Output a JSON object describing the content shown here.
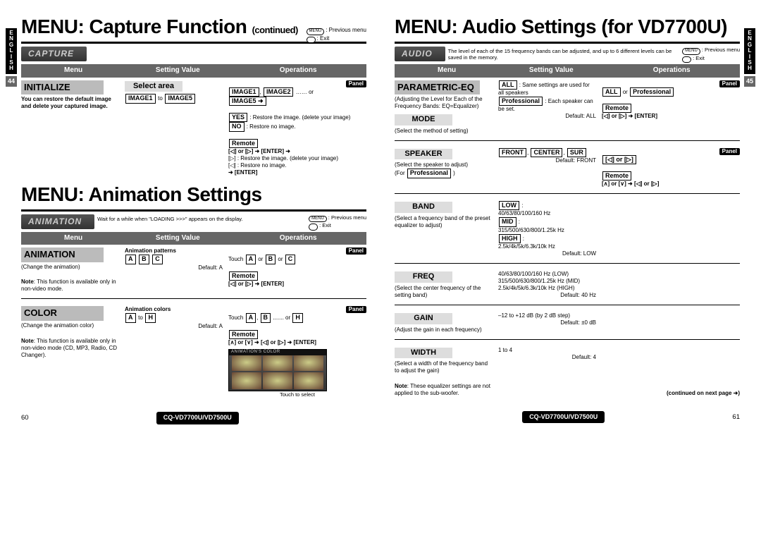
{
  "side_tab": "ENGLISH",
  "side_page_left": "44",
  "side_page_right": "45",
  "foot_left_page": "60",
  "foot_right_page": "61",
  "foot_model": "CQ-VD7700U/VD7500U",
  "nav_prev": ": Previous menu",
  "nav_exit": ": Exit",
  "left": {
    "title1": "MENU: Capture Function",
    "title1_cont": "(continued)",
    "capbar1": "CAPTURE",
    "cols": {
      "menu": "Menu",
      "setting": "Setting Value",
      "ops": "Operations"
    },
    "initialize": {
      "label": "INITIALIZE",
      "desc": "You can restore the default image and delete your captured image.",
      "select_area": "Select area",
      "range1": "IMAGE1",
      "range_to": "to",
      "range2": "IMAGE5",
      "ops1a": "IMAGE1",
      "ops1b": "IMAGE2",
      "ops1c": "…… or",
      "ops1d": "IMAGE5",
      "yes": "YES",
      "yes_desc": ": Restore the image. (delete your image)",
      "no": "NO",
      "no_desc": ": Restore no image.",
      "panel": "Panel",
      "remote": "Remote",
      "remote_line1": "[◁] or [▷] ➜ [ENTER] ➜",
      "remote_line2": "[▷] : Restore the image. (delete your image)",
      "remote_line3": "[◁] : Restore no image.",
      "remote_line4": "➜ [ENTER]"
    },
    "title2": "MENU: Animation Settings",
    "capbar2": "ANIMATION",
    "loading_note": "Wait for a while when \"LOADING >>>\" appears on the display.",
    "animation": {
      "label": "ANIMATION",
      "desc1": "(Change the animation)",
      "note_bold": "Note",
      "desc2": ": This function is available only in non-video mode.",
      "patterns_hdr": "Animation patterns",
      "a": "A",
      "b": "B",
      "c": "C",
      "default": "Default: A",
      "ops_panel": "Panel",
      "ops_touch1": "Touch ",
      "ops_remote": "Remote",
      "ops_remote_line": "[◁] or [▷] ➜ [ENTER]"
    },
    "color": {
      "label": "COLOR",
      "desc1": "(Change the animation color)",
      "desc2": ": This function is available only in non-video mode (CD, MP3, Radio, CD Changer).",
      "colors_hdr": "Animation colors",
      "a": "A",
      "to": "to",
      "h": "H",
      "default": "Default: A",
      "ops_panel": "Panel",
      "ops_touch": "Touch ",
      "touch_a": "A",
      "touch_b": "B",
      "touch_dots": "....... or",
      "touch_h": "H",
      "ops_remote": "Remote",
      "ops_remote_line": "[∧] or [∨] ➜ [◁] or [▷] ➜ [ENTER]",
      "screenshot_hdr": "ANIMATION'S COLOR",
      "touch_select": "Touch to select"
    }
  },
  "right": {
    "title": "MENU: Audio Settings (for VD7700U)",
    "capbar": "AUDIO",
    "intro": "The level of each of the 15 frequency bands can be adjusted, and up to 6 different levels can be saved in the memory.",
    "cols": {
      "menu": "Menu",
      "setting": "Setting Value",
      "ops": "Operations"
    },
    "peq": {
      "label": "PARAMETRIC-EQ",
      "desc": "(Adjusting the Level for Each of the Frequency Bands: EQ=Equalizer)",
      "all": "ALL",
      "all_desc": ": Same settings are used for all speakers",
      "pro": "Professional",
      "pro_desc": ": Each speaker can be set.",
      "default": "Default: ALL",
      "panel": "Panel",
      "ops_or": "or",
      "remote": "Remote",
      "ops_remote": "[◁] or [▷] ➜ [ENTER]"
    },
    "mode": {
      "label": "MODE",
      "desc": "(Select the method of setting)"
    },
    "speaker": {
      "label": "SPEAKER",
      "desc": "(Select the speaker to adjust)",
      "for": "(For",
      "front": "FRONT",
      "center": "CENTER",
      "sur": "SUR",
      "default": "Default: FRONT",
      "panel": "Panel",
      "arrows": "[◁] or [▷]",
      "remote": "Remote",
      "remote_line": "[∧] or [∨] ➜ [◁] or [▷]"
    },
    "band": {
      "label": "BAND",
      "desc": "(Select a frequency band of the preset equalizer to adjust)",
      "low": "LOW",
      "mid": "MID",
      "high": "HIGH",
      "low_desc": "40/63/80/100/160 Hz",
      "mid_desc": "315/500/630/800/1.25k Hz",
      "high_desc": "2.5k/4k/5k/6.3k/10k Hz",
      "default": "Default: LOW"
    },
    "freq": {
      "label": "FREQ",
      "desc": "(Select the center frequency of the setting band)",
      "line1": "40/63/80/100/160 Hz (LOW)",
      "line2": "315/500/630/800/1.25k Hz (MID)",
      "line3": "2.5k/4k/5k/6.3k/10k Hz (HIGH)",
      "default": "Default: 40 Hz"
    },
    "gain": {
      "label": "GAIN",
      "desc": "(Adjust the gain in each frequency)",
      "range": "–12 to +12 dB (by 2 dB step)",
      "default": "Default: ±0 dB"
    },
    "width": {
      "label": "WIDTH",
      "desc": "(Select a width of the frequency band to adjust the gain)",
      "range": "1 to 4",
      "default": "Default: 4"
    },
    "eq_note_bold": "Note",
    "eq_note": ": These equalizer settings are not applied to the sub-woofer.",
    "cont_next": "(continued on next page ➜)"
  }
}
